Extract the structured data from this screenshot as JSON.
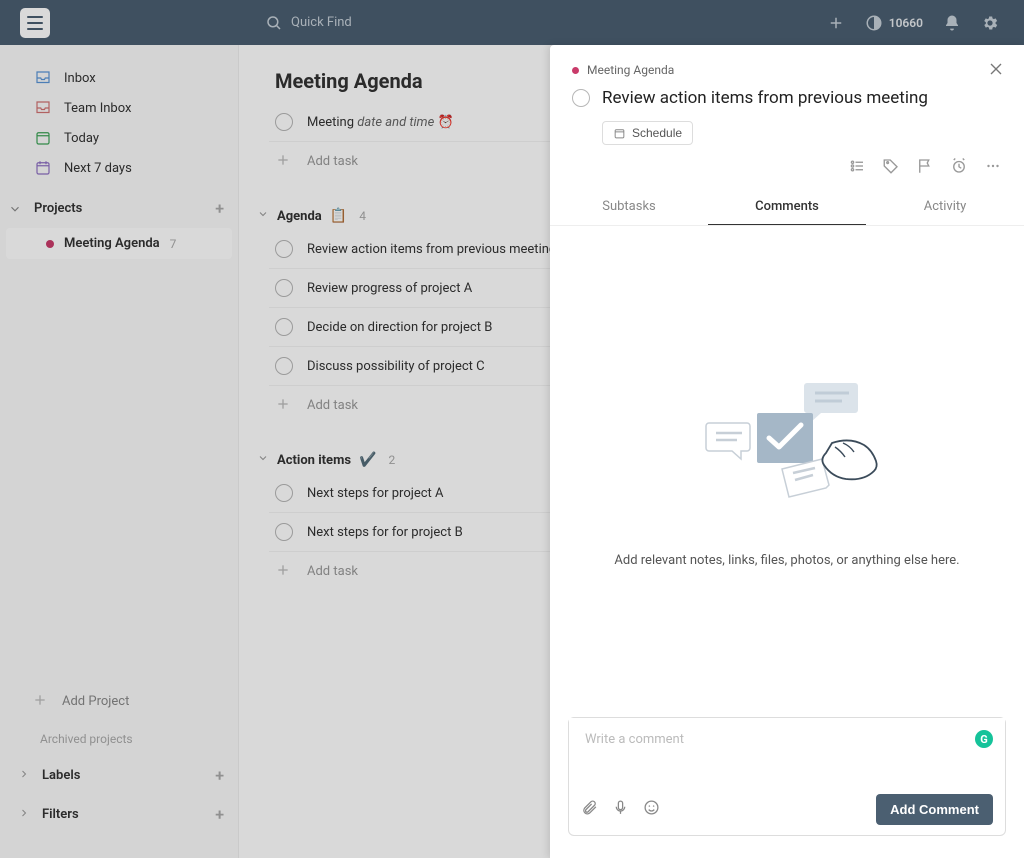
{
  "topbar": {
    "search_placeholder": "Quick Find",
    "karma_count": "10660"
  },
  "sidebar": {
    "nav": {
      "inbox": "Inbox",
      "team_inbox": "Team Inbox",
      "today": "Today",
      "next7": "Next 7 days"
    },
    "projects_label": "Projects",
    "projects": [
      {
        "name": "Meeting Agenda",
        "count": "7"
      }
    ],
    "add_project": "Add Project",
    "archived_label": "Archived projects",
    "labels_label": "Labels",
    "filters_label": "Filters"
  },
  "main": {
    "title": "Meeting Agenda",
    "top_task": {
      "prefix": "Meeting ",
      "italic": "date and time "
    },
    "add_task": "Add task",
    "sections": [
      {
        "name": "Agenda",
        "emoji": "📋",
        "count": "4",
        "tasks": [
          "Review action items from previous meeting",
          "Review progress of project A",
          "Decide on direction for project B",
          "Discuss possibility of project C"
        ]
      },
      {
        "name": "Action items",
        "emoji": "✔️",
        "count": "2",
        "tasks": [
          "Next steps for project A",
          "Next steps for for project B"
        ]
      }
    ]
  },
  "panel": {
    "crumb_project": "Meeting Agenda",
    "task_title": "Review action items from previous meeting",
    "schedule_label": "Schedule",
    "tabs": {
      "subtasks": "Subtasks",
      "comments": "Comments",
      "activity": "Activity"
    },
    "placeholder": "Add relevant notes, links, files, photos, or anything else here.",
    "comment_placeholder": "Write a comment",
    "add_comment_btn": "Add Comment",
    "grammarly_badge": "G"
  }
}
